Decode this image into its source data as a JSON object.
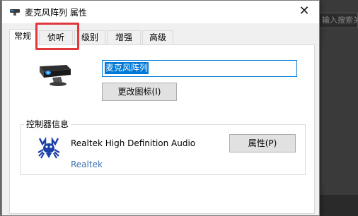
{
  "background": {
    "search_placeholder": "输入搜索关"
  },
  "dialog": {
    "title": "麦克风阵列 属性",
    "close_glyph": "✕",
    "tabs": [
      {
        "label": "常规",
        "active": true
      },
      {
        "label": "侦听",
        "active": false,
        "highlighted": true
      },
      {
        "label": "级别",
        "active": false
      },
      {
        "label": "增强",
        "active": false
      },
      {
        "label": "高级",
        "active": false
      }
    ],
    "device_name_value": "麦克风阵列",
    "change_icon_label": "更改图标(I)",
    "controller_group_label": "控制器信息",
    "controller_name": "Realtek High Definition Audio",
    "controller_vendor_link": "Realtek",
    "properties_label": "属性(P)"
  },
  "colors": {
    "highlight": "#e0383b",
    "selection": "#0078d7",
    "link": "#3b6fb6"
  },
  "icons": {
    "title_icon": "microphone-array-icon",
    "device_icon": "microphone-array-icon",
    "vendor_logo": "realtek-crab-logo"
  }
}
